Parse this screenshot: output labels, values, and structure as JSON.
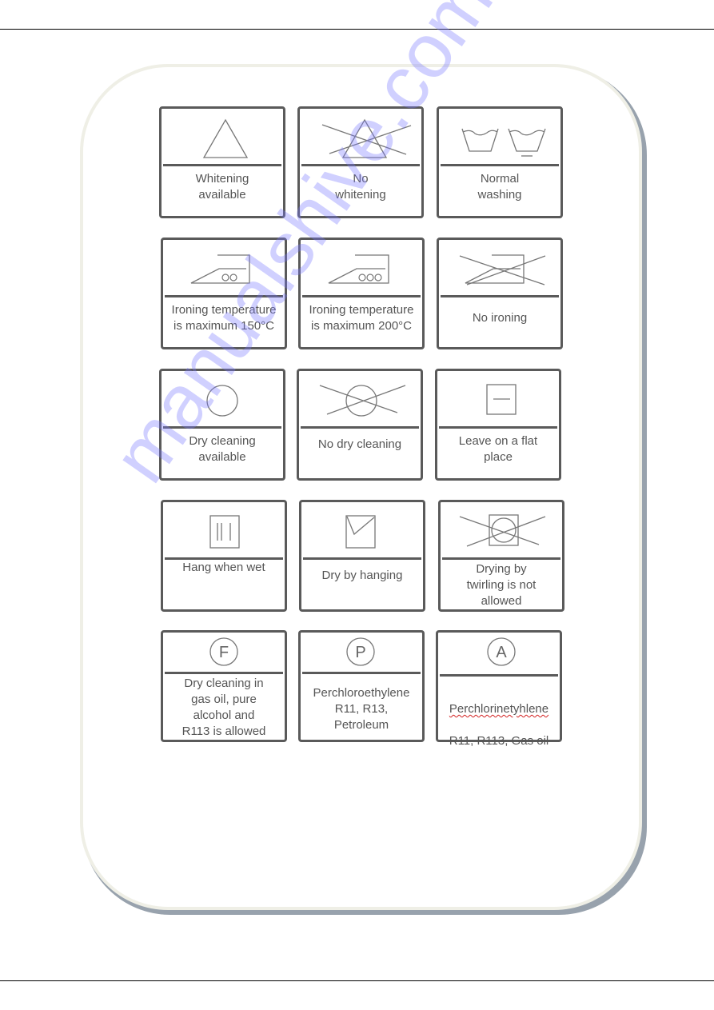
{
  "watermark": "manualshive.com",
  "symbols": [
    {
      "id": "whitening-available",
      "label": "Whitening\navailable",
      "icon": "triangle-icon"
    },
    {
      "id": "no-whitening",
      "label": "No\nwhitening",
      "icon": "crossed-triangle-icon"
    },
    {
      "id": "normal-washing",
      "label": "Normal\nwashing",
      "icon": "wash-tub-icon"
    },
    {
      "id": "ironing-150",
      "label": "Ironing temperature\nis maximum 150°C",
      "icon": "iron-two-dots-icon"
    },
    {
      "id": "ironing-200",
      "label": "Ironing temperature\nis maximum 200°C",
      "icon": "iron-three-dots-icon"
    },
    {
      "id": "no-ironing",
      "label": "No ironing",
      "icon": "crossed-iron-icon"
    },
    {
      "id": "dry-cleaning-available",
      "label": "Dry cleaning\navailable",
      "icon": "circle-icon"
    },
    {
      "id": "no-dry-cleaning",
      "label": "No dry cleaning",
      "icon": "crossed-circle-icon"
    },
    {
      "id": "flat-dry",
      "label": "Leave on a flat\nplace",
      "icon": "square-flat-line-icon"
    },
    {
      "id": "hang-when-wet",
      "label": "Hang when wet",
      "icon": "square-drip-lines-icon"
    },
    {
      "id": "dry-by-hanging",
      "label": "Dry by hanging",
      "icon": "square-hanging-icon"
    },
    {
      "id": "no-tumble-dry",
      "label": "Drying by\ntwirling is not\nallowed",
      "icon": "crossed-tumble-dry-icon"
    },
    {
      "id": "dry-clean-f",
      "label": "Dry cleaning in\ngas oil, pure\nalcohol and\nR113 is allowed",
      "icon": "circle-letter-icon",
      "letter": "F"
    },
    {
      "id": "dry-clean-p",
      "label": "Perchloroethylene\nR11, R13,\nPetroleum",
      "icon": "circle-letter-icon",
      "letter": "P"
    },
    {
      "id": "dry-clean-a",
      "label_line1": "Perchlorinetyhlene",
      "label_line2": "R11, R113, Gas oil",
      "icon": "circle-letter-icon",
      "letter": "A"
    }
  ]
}
